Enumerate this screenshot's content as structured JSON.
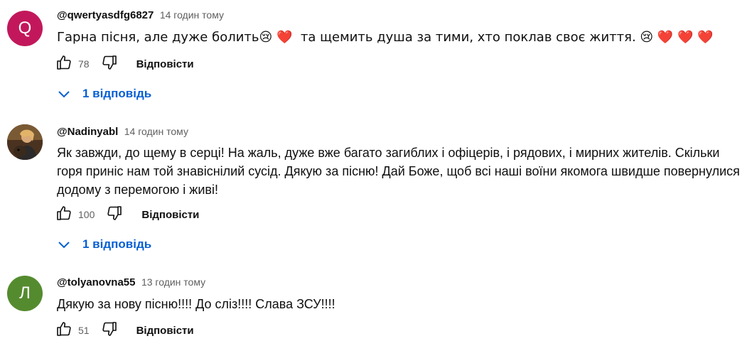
{
  "comments": [
    {
      "avatar_letter": "Q",
      "avatar_color": "#c2185b",
      "author": "@qwertyasdfg6827",
      "time": "14 годин тому",
      "text": "Гарна пісня, але дуже болить😢 ❤️  та щемить душа за тими, хто поклав своє життя. 😢 ❤️ ❤️ ❤️",
      "likes": "78",
      "reply_label": "Відповісти",
      "replies_label": "1 відповідь"
    },
    {
      "avatar_letter": "",
      "avatar_color": "#6b4a2e",
      "author": "@Nadinyabl",
      "time": "14 годин тому",
      "text": "Як завжди, до щему в серці! На жаль, дуже вже багато загиблих і офіцерів, і рядових, і мирних жителів. Скільки горя приніс нам той знавіснілий сусід. Дякую за пісню! Дай Боже, щоб всі наші воїни якомога швидше повернулися додому з перемогою і живі!",
      "likes": "100",
      "reply_label": "Відповісти",
      "replies_label": "1 відповідь"
    },
    {
      "avatar_letter": "Л",
      "avatar_color": "#558b2f",
      "author": "@tolyanovna55",
      "time": "13 годин тому",
      "text": "Дякую за нову пісню!!!! До сліз!!!! Слава ЗСУ!!!!",
      "likes": "51",
      "reply_label": "Відповісти"
    }
  ],
  "colors": {
    "link": "#065fd4",
    "muted": "#606060"
  }
}
